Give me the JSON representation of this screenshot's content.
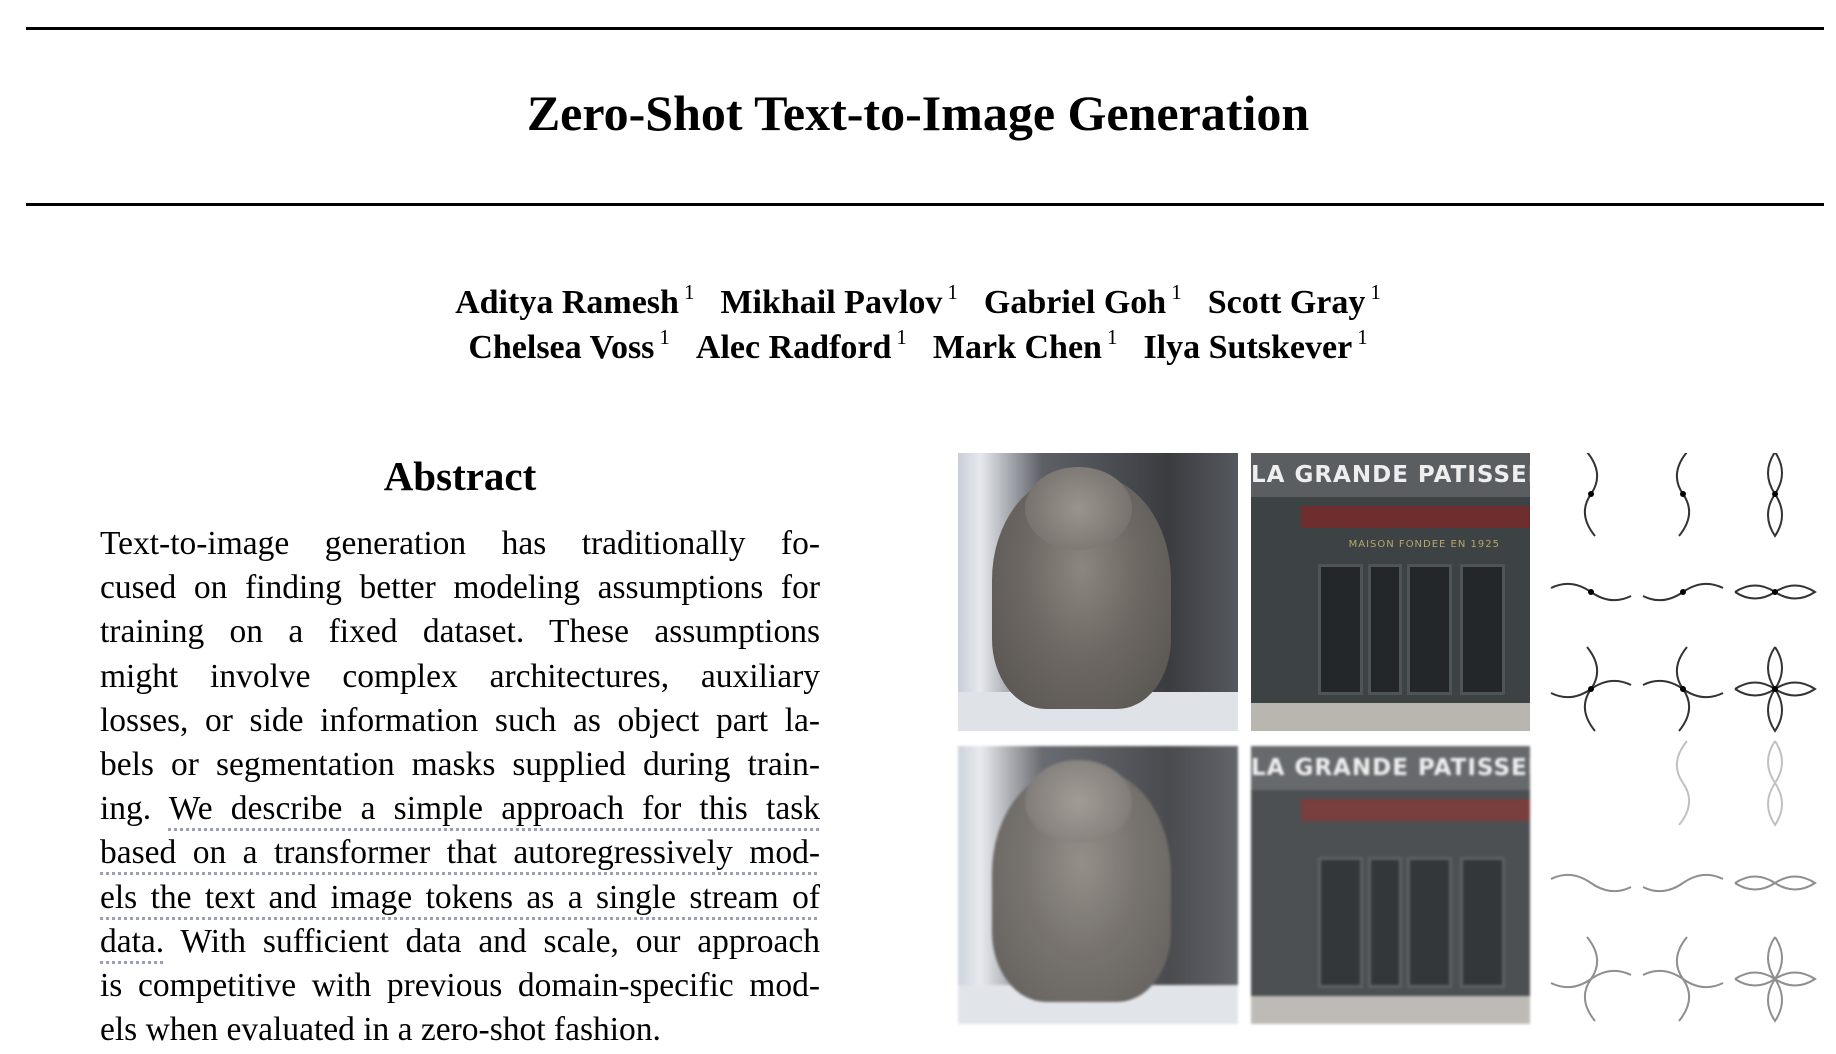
{
  "paper": {
    "title": "Zero-Shot Text-to-Image Generation",
    "authors_row1": [
      {
        "name": "Aditya Ramesh",
        "affil": "1"
      },
      {
        "name": "Mikhail Pavlov",
        "affil": "1"
      },
      {
        "name": "Gabriel Goh",
        "affil": "1"
      },
      {
        "name": "Scott Gray",
        "affil": "1"
      }
    ],
    "authors_row2": [
      {
        "name": "Chelsea Voss",
        "affil": "1"
      },
      {
        "name": "Alec Radford",
        "affil": "1"
      },
      {
        "name": "Mark Chen",
        "affil": "1"
      },
      {
        "name": "Ilya Sutskever",
        "affil": "1"
      }
    ],
    "abstract_heading": "Abstract",
    "abstract_lines": [
      {
        "pre": "Text-to-image generation has traditionally fo-",
        "link": "",
        "post": ""
      },
      {
        "pre": "cused on finding better modeling assumptions for",
        "link": "",
        "post": ""
      },
      {
        "pre": "training on a fixed dataset.  These assumptions",
        "link": "",
        "post": ""
      },
      {
        "pre": "might involve complex architectures, auxiliary",
        "link": "",
        "post": ""
      },
      {
        "pre": "losses, or side information such as object part la-",
        "link": "",
        "post": ""
      },
      {
        "pre": "bels or segmentation masks supplied during train-",
        "link": "",
        "post": ""
      },
      {
        "pre": "ing. ",
        "link": "We describe a simple approach for this task",
        "post": ""
      },
      {
        "pre": "",
        "link": "based on a transformer that autoregressively mod-",
        "post": ""
      },
      {
        "pre": "",
        "link": "els the text and image tokens as a single stream of",
        "post": ""
      },
      {
        "pre": "",
        "link": "data.",
        "post": " With sufficient data and scale, our approach"
      },
      {
        "pre": "is competitive with previous domain-specific mod-",
        "link": "",
        "post": ""
      },
      {
        "pre": "els when evaluated in a zero-shot fashion.",
        "link": "",
        "post": ""
      }
    ]
  },
  "figure": {
    "shop_sign": "LA GRANDE PATISSERIE",
    "shop_sign_reconstructed": "LA GRANDE PATISSERIE",
    "shop_subtitle": "MAISON FONDEE EN 1925"
  }
}
